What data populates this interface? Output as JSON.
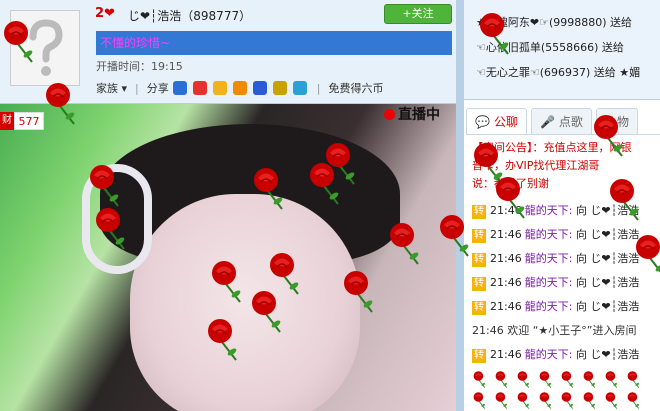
{
  "header": {
    "level": "2",
    "anchor_name": "じ❤┆浩浩（898777）",
    "follow_label": "+关注",
    "tagline": "不懂的珍惜~",
    "airtime": "开播时间：19:15",
    "family_label": "家族",
    "share_label": "分享",
    "free_coins_label": "免费得六币"
  },
  "sidebar": {
    "badge": "财",
    "count": "577"
  },
  "video": {
    "live_label": "直播中"
  },
  "gifts": [
    "★龍魄阿东❤☞(9998880) 送给",
    "☜心依旧孤单(5558666) 送给",
    "☜无心之罪☜(696937) 送给 ★媚"
  ],
  "tabs": [
    {
      "label": "公聊",
      "icon": "chat-bubble-icon"
    },
    {
      "label": "点歌",
      "icon": "mic-icon"
    },
    {
      "label": "礼物",
      "icon": "gift-icon"
    }
  ],
  "chat": {
    "announce_1": "【房间公告】：充值点这里，网银",
    "announce_2": "普卡，办VIP找代理江湖哥",
    "announce_3": "说：都说了别谢",
    "messages": [
      {
        "tag": "转",
        "time": "21:46",
        "user": "龍的天下:",
        "to": "向 じ❤┆浩浩"
      },
      {
        "tag": "转",
        "time": "21:46",
        "user": "龍的天下:",
        "to": "向 じ❤┆浩浩"
      },
      {
        "tag": "转",
        "time": "21:46",
        "user": "龍的天下:",
        "to": "向 じ❤┆浩浩"
      },
      {
        "tag": "转",
        "time": "21:46",
        "user": "龍的天下:",
        "to": "向 じ❤┆浩浩"
      },
      {
        "tag": "转",
        "time": "21:46",
        "user": "龍的天下:",
        "to": "向 じ❤┆浩浩"
      }
    ],
    "system_msg": "21:46 欢迎 “★小王子°”进入房间",
    "last_message": {
      "tag": "转",
      "time": "21:46",
      "user": "龍的天下:",
      "to": "向 じ❤┆浩浩"
    }
  },
  "colors": {
    "accent_blue": "#3478d6",
    "follow_green": "#4eb43a",
    "rose_red": "#d40000"
  }
}
